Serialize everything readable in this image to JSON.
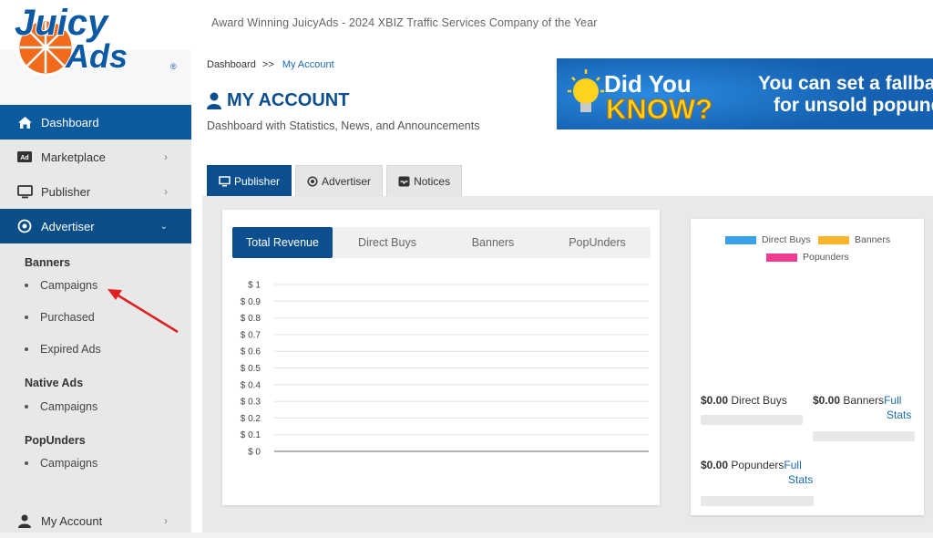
{
  "brand": {
    "logo_text_1": "Juicy",
    "logo_text_2": "Ads",
    "registered": "®"
  },
  "tagline": "Award Winning JuicyAds - 2024 XBIZ Traffic Services Company of the Year",
  "sidebar": {
    "items": [
      {
        "label": "Dashboard",
        "icon": "home-icon"
      },
      {
        "label": "Marketplace",
        "icon": "ad-icon"
      },
      {
        "label": "Publisher",
        "icon": "monitor-icon"
      },
      {
        "label": "Advertiser",
        "icon": "target-icon"
      }
    ],
    "sections": [
      {
        "title": "Banners",
        "items": [
          "Campaigns",
          "Purchased",
          "Expired Ads"
        ]
      },
      {
        "title": "Native Ads",
        "items": [
          "Campaigns"
        ]
      },
      {
        "title": "PopUnders",
        "items": [
          "Campaigns"
        ]
      }
    ],
    "account": {
      "label": "My Account",
      "icon": "user-icon"
    }
  },
  "breadcrumb": {
    "root": "Dashboard",
    "sep": ">>",
    "current": "My Account"
  },
  "page": {
    "title": "MY ACCOUNT",
    "subtitle": "Dashboard with Statistics, News, and Announcements"
  },
  "banner": {
    "line1": "Did You",
    "line2": "KNOW?",
    "text1": "You can set a fallback",
    "text2": "for unsold popunder"
  },
  "tabs": [
    {
      "label": "Publisher",
      "icon": "monitor-icon",
      "active": true
    },
    {
      "label": "Advertiser",
      "icon": "target-icon",
      "active": false
    },
    {
      "label": "Notices",
      "icon": "inbox-icon",
      "active": false
    }
  ],
  "chart_tabs": [
    "Total Revenue",
    "Direct Buys",
    "Banners",
    "PopUnders"
  ],
  "chart_data": {
    "type": "line",
    "title": "",
    "xlabel": "",
    "ylabel": "",
    "y_ticks": [
      "$ 1",
      "$ 0.9",
      "$ 0.8",
      "$ 0.7",
      "$ 0.6",
      "$ 0.5",
      "$ 0.4",
      "$ 0.3",
      "$ 0.2",
      "$ 0.1",
      "$ 0"
    ],
    "ylim": [
      0,
      1
    ],
    "grid": true,
    "series": []
  },
  "legend": [
    {
      "name": "Direct Buys",
      "color": "#3aa0e8"
    },
    {
      "name": "Banners",
      "color": "#f7b42c"
    },
    {
      "name": "Popunders",
      "color": "#ee3d8f"
    }
  ],
  "stats": {
    "direct_buys": {
      "amount": "$0.00",
      "label": " Direct Buys"
    },
    "banners": {
      "amount": "$0.00",
      "label": " Banners",
      "link1": "Full",
      "link2": "Stats"
    },
    "popunders": {
      "amount": "$0.00",
      "label": " Popunders",
      "link1": "Full",
      "link2": "Stats"
    }
  },
  "colors": {
    "primary": "#0c4f8f",
    "link": "#1a6bb5",
    "accent_arrow": "#e02020"
  }
}
